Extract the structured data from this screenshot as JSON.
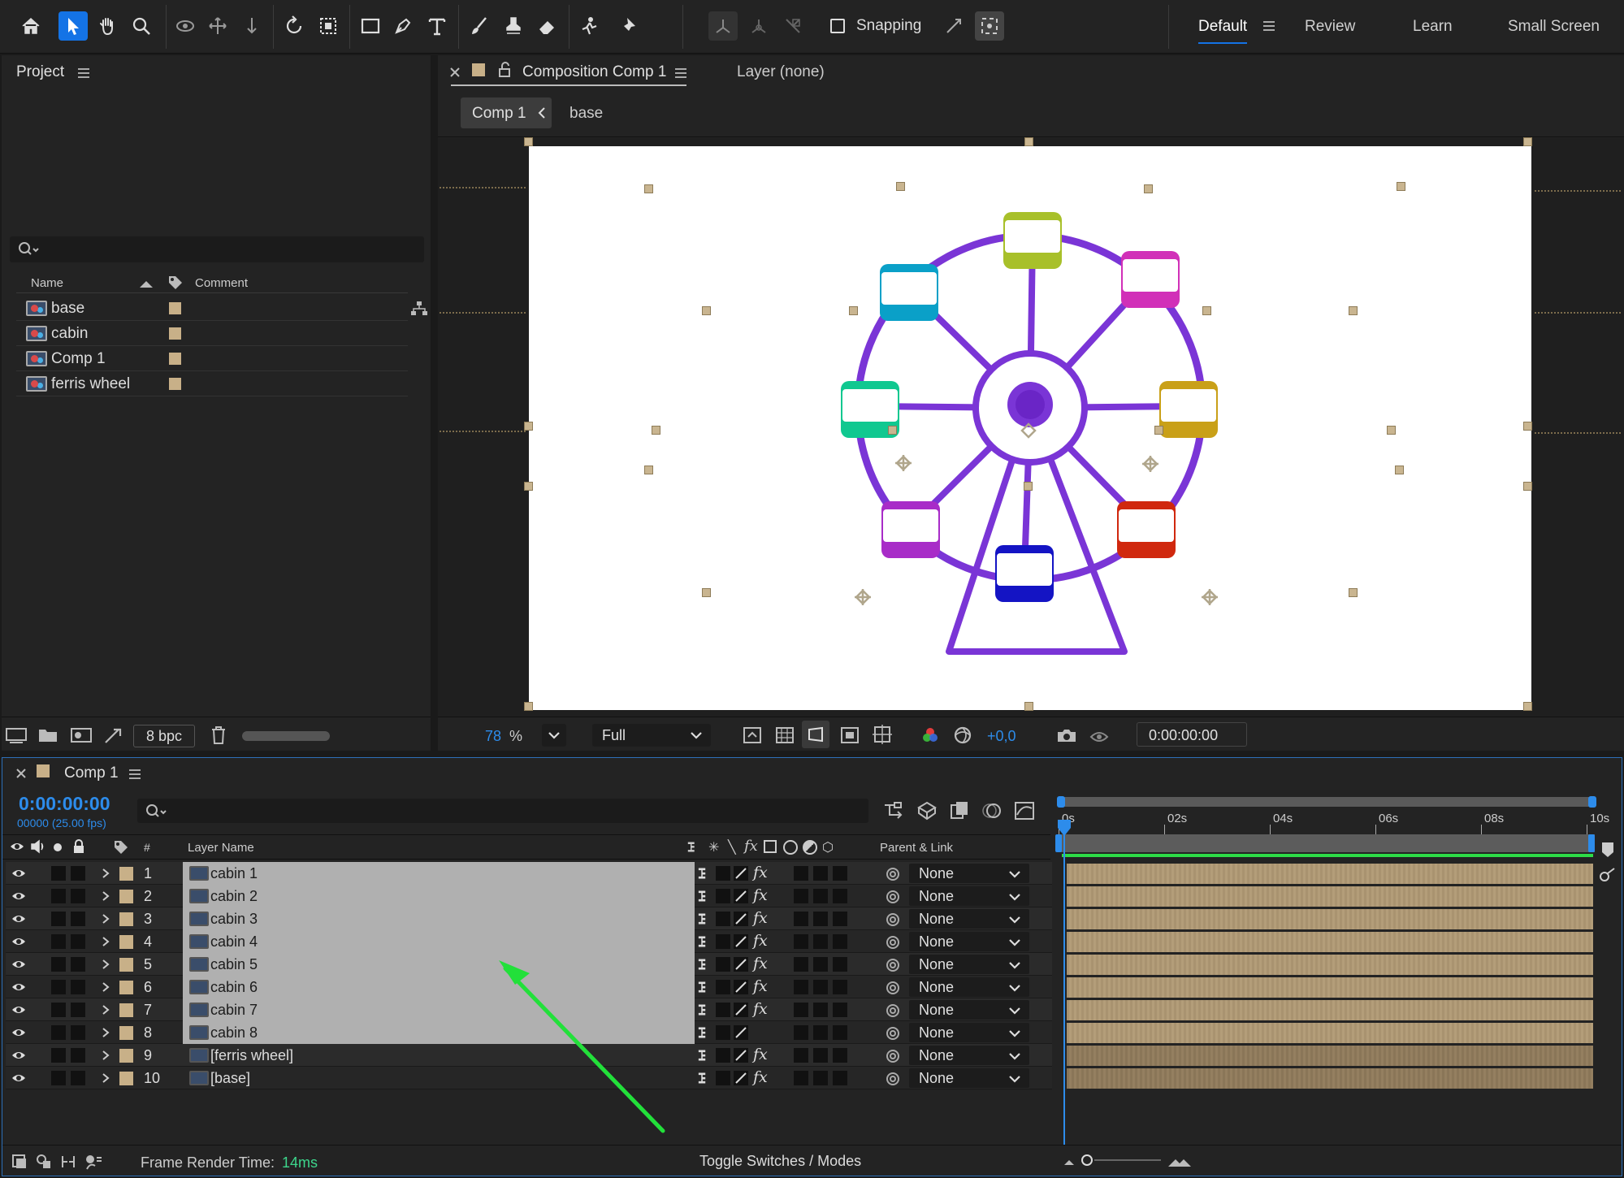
{
  "toolbar": {
    "snapping_label": "Snapping",
    "workspaces": [
      "Default",
      "Review",
      "Learn",
      "Small Screen"
    ],
    "active_workspace": "Default"
  },
  "project": {
    "title": "Project",
    "columns": {
      "name": "Name",
      "comment": "Comment"
    },
    "items": [
      {
        "name": "base"
      },
      {
        "name": "cabin"
      },
      {
        "name": "Comp 1"
      },
      {
        "name": "ferris wheel"
      }
    ],
    "bpc": "8 bpc"
  },
  "viewer": {
    "tab_title": "Composition Comp 1",
    "layer_tab": "Layer (none)",
    "breadcrumb": {
      "comp": "Comp 1",
      "sub": "base"
    },
    "zoom": "78",
    "zoom_unit": "%",
    "resolution": "Full",
    "exposure": "+0,0",
    "timecode": "0:00:00:00"
  },
  "timeline": {
    "tab_title": "Comp 1",
    "timecode": "0:00:00:00",
    "frames": "00000 (25.00 fps)",
    "col_num": "#",
    "col_layer": "Layer Name",
    "col_parent": "Parent & Link",
    "ruler": [
      "0s",
      "02s",
      "04s",
      "06s",
      "08s",
      "10s"
    ],
    "layers": [
      {
        "num": "1",
        "name": "cabin 1",
        "parent": "None",
        "fx": true,
        "selected": true
      },
      {
        "num": "2",
        "name": "cabin 2",
        "parent": "None",
        "fx": true,
        "selected": true
      },
      {
        "num": "3",
        "name": "cabin 3",
        "parent": "None",
        "fx": true,
        "selected": true
      },
      {
        "num": "4",
        "name": "cabin 4",
        "parent": "None",
        "fx": true,
        "selected": true
      },
      {
        "num": "5",
        "name": "cabin 5",
        "parent": "None",
        "fx": true,
        "selected": true
      },
      {
        "num": "6",
        "name": "cabin 6",
        "parent": "None",
        "fx": true,
        "selected": true
      },
      {
        "num": "7",
        "name": "cabin 7",
        "parent": "None",
        "fx": true,
        "selected": true
      },
      {
        "num": "8",
        "name": "cabin 8",
        "parent": "None",
        "fx": false,
        "selected": true
      },
      {
        "num": "9",
        "name": "[ferris wheel]",
        "parent": "None",
        "fx": true,
        "selected": false
      },
      {
        "num": "10",
        "name": "[base]",
        "parent": "None",
        "fx": true,
        "selected": false
      }
    ],
    "frame_render_label": "Frame Render Time:",
    "frame_render_value": "14ms",
    "toggle_label": "Toggle Switches / Modes"
  },
  "colors": {
    "accent": "#1473e6",
    "timecode": "#2d8ceb",
    "render_time": "#3dd68c",
    "label": "#c8b088",
    "wheel": "#7a35d6",
    "annotation_arrow": "#22e03a"
  },
  "cabins": [
    {
      "color": "#a8c02a"
    },
    {
      "color": "#d130b8"
    },
    {
      "color": "#c9a018"
    },
    {
      "color": "#d0280e"
    },
    {
      "color": "#1414c4"
    },
    {
      "color": "#a82cc8"
    },
    {
      "color": "#10c890"
    },
    {
      "color": "#0aa0c8"
    }
  ]
}
